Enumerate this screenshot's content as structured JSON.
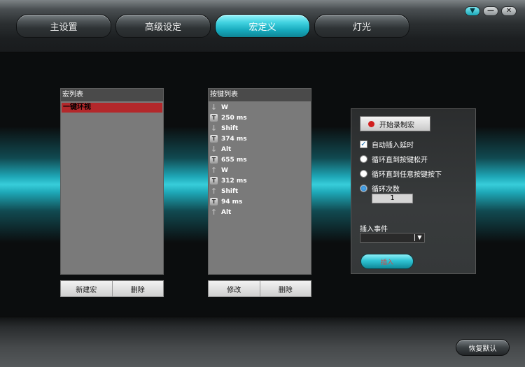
{
  "tabs": [
    {
      "label": "主设置",
      "active": false
    },
    {
      "label": "高级设定",
      "active": false
    },
    {
      "label": "宏定义",
      "active": true
    },
    {
      "label": "灯光",
      "active": false
    }
  ],
  "window_buttons": {
    "down": "▼",
    "minimize": "—",
    "close": "✕"
  },
  "macro_list": {
    "header": "宏列表",
    "items": [
      "一键环视"
    ],
    "selected_index": 0,
    "new_button": "新建宏",
    "delete_button": "删除"
  },
  "key_list": {
    "header": "按键列表",
    "items": [
      {
        "icon": "arrow-down",
        "text": "W"
      },
      {
        "icon": "delay",
        "text": "250 ms"
      },
      {
        "icon": "arrow-down",
        "text": "Shift"
      },
      {
        "icon": "delay",
        "text": "374 ms"
      },
      {
        "icon": "arrow-down",
        "text": "Alt"
      },
      {
        "icon": "delay",
        "text": "655 ms"
      },
      {
        "icon": "arrow-up",
        "text": "W"
      },
      {
        "icon": "delay",
        "text": "312 ms"
      },
      {
        "icon": "arrow-up",
        "text": "Shift"
      },
      {
        "icon": "delay",
        "text": "94 ms"
      },
      {
        "icon": "arrow-up",
        "text": "Alt"
      }
    ],
    "modify_button": "修改",
    "delete_button": "删除",
    "delay_glyph": "T"
  },
  "record": {
    "start_button": "开始录制宏",
    "auto_delay": {
      "label": "自动插入延时",
      "checked": true
    },
    "options": [
      {
        "label": "循环直到按键松开",
        "selected": false
      },
      {
        "label": "循环直到任意按键按下",
        "selected": false
      },
      {
        "label": "循环次数",
        "selected": true
      }
    ],
    "loop_count": "1",
    "insert_event_label": "插入事件",
    "insert_event_value": "",
    "insert_button": "插入"
  },
  "footer": {
    "restore_button": "恢复默认"
  },
  "colors": {
    "accent_cyan": "#37cdda",
    "selected_row": "#b3282b",
    "record_dot": "#d11f1f"
  }
}
